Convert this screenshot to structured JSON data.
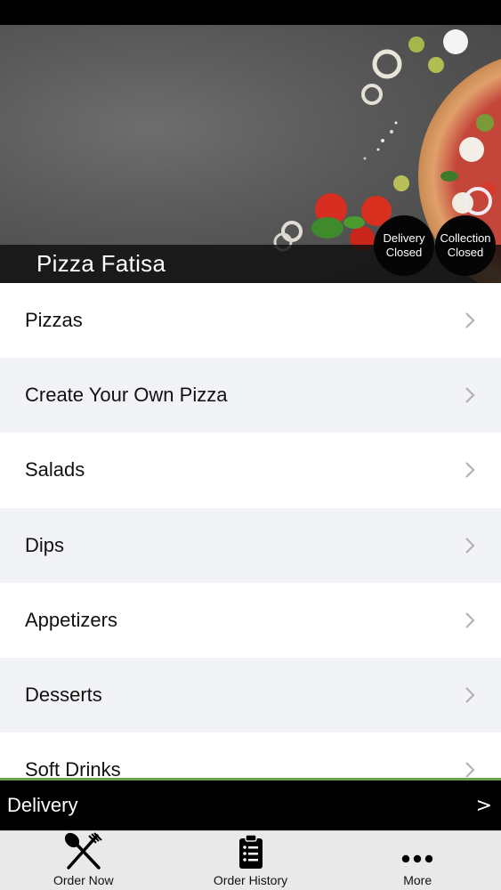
{
  "header": {
    "restaurant_name": "Pizza Fatisa",
    "delivery_badge": {
      "line1": "Delivery",
      "line2": "Closed"
    },
    "collection_badge": {
      "line1": "Collection",
      "line2": "Closed"
    }
  },
  "menu": {
    "items": [
      {
        "label": "Pizzas"
      },
      {
        "label": "Create Your Own Pizza"
      },
      {
        "label": "Salads"
      },
      {
        "label": "Dips"
      },
      {
        "label": "Appetizers"
      },
      {
        "label": "Desserts"
      },
      {
        "label": "Soft Drinks"
      }
    ],
    "chevron_icon": "chevron-right-icon"
  },
  "order_mode_bar": {
    "label": "Delivery",
    "arrow": ">"
  },
  "tabbar": {
    "tabs": [
      {
        "label": "Order Now",
        "icon": "fork-knife-icon"
      },
      {
        "label": "Order History",
        "icon": "clipboard-list-icon"
      },
      {
        "label": "More",
        "icon": "more-dots-icon"
      }
    ]
  },
  "colors": {
    "accent_green": "#67a14a",
    "bar_black": "#000000",
    "tabbar_bg": "#e9e9e9",
    "alt_row_bg": "#f2f3f6"
  }
}
